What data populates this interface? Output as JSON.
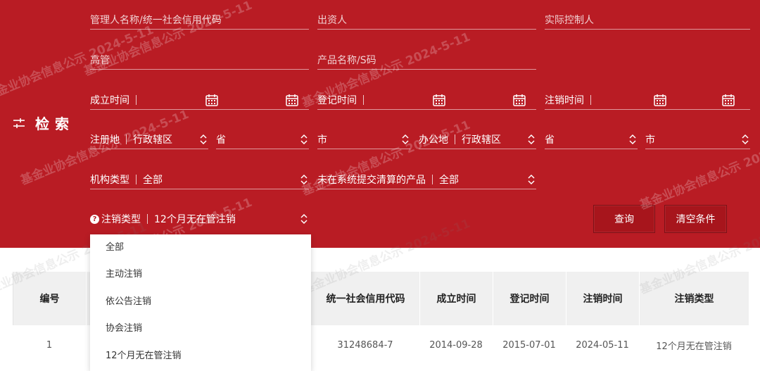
{
  "search": {
    "title": "检索",
    "manager_placeholder": "管理人名称/统一社会信用代码",
    "investor_placeholder": "出资人",
    "controller_placeholder": "实际控制人",
    "executive_placeholder": "高管",
    "product_placeholder": "产品名称/S码",
    "established_label": "成立时间",
    "registered_label": "登记时间",
    "cancelled_label": "注销时间",
    "reg_location_label": "注册地",
    "reg_district_value": "行政辖区",
    "reg_province_value": "省",
    "reg_city_value": "市",
    "office_label": "办公地",
    "office_district_value": "行政辖区",
    "office_province_value": "省",
    "office_city_value": "市",
    "org_type_label": "机构类型",
    "org_type_value": "全部",
    "unsettled_label": "未在系统提交清算的产品",
    "unsettled_value": "全部",
    "cancel_type_label": "注销类型",
    "cancel_type_value": "12个月无在管注销",
    "help_glyph": "?",
    "query_button": "查询",
    "clear_button": "清空条件"
  },
  "dropdown": {
    "options": [
      "全部",
      "主动注销",
      "依公告注销",
      "协会注销",
      "12个月无在管注销"
    ]
  },
  "table": {
    "headers": [
      "编号",
      "统一社会信用代码",
      "成立时间",
      "登记时间",
      "注销时间",
      "注销类型"
    ],
    "rows": [
      [
        "1",
        "31248684-7",
        "2014-09-28",
        "2015-07-01",
        "2024-05-11",
        "12个月无在管注销"
      ]
    ]
  },
  "watermark": {
    "text": "基金业协会信息公示 2024-5-11"
  },
  "colors": {
    "panel": "#b91c24",
    "button": "#a7151c",
    "header_bg": "#f0f0f0"
  },
  "icons": [
    "filter-sliders-icon",
    "calendar-icon",
    "sort-arrows-icon",
    "help-circle-icon"
  ]
}
